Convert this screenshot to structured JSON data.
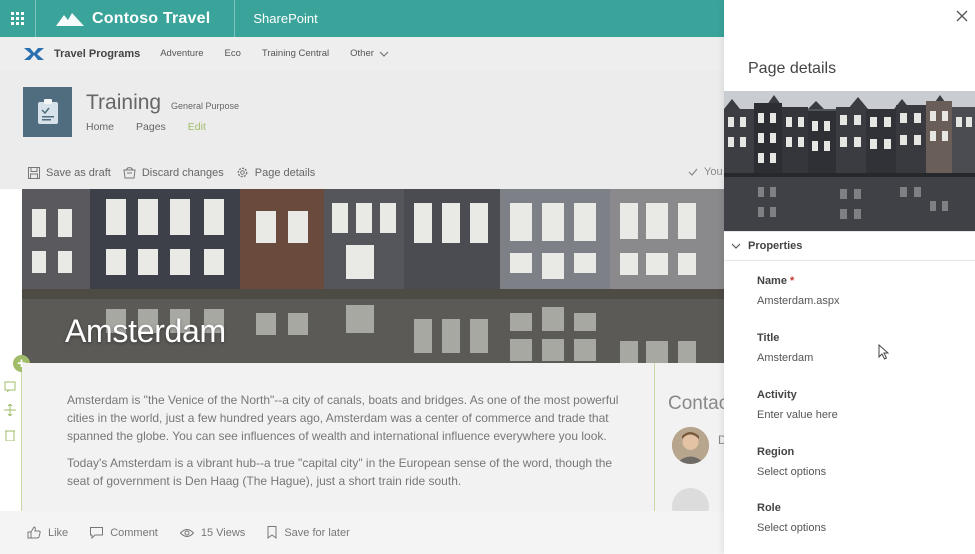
{
  "suite": {
    "brand": "Contoso Travel",
    "product": "SharePoint"
  },
  "hub": {
    "title": "Travel Programs",
    "links": [
      "Adventure",
      "Eco",
      "Training Central",
      "Other"
    ]
  },
  "site": {
    "title": "Training",
    "classification": "General Purpose",
    "nav": [
      "Home",
      "Pages",
      "Edit"
    ]
  },
  "commands": {
    "save_draft": "Save as draft",
    "discard": "Discard changes",
    "page_details": "Page details",
    "status": "You"
  },
  "hero": {
    "title": "Amsterdam"
  },
  "article": {
    "paragraphs": [
      "Amsterdam is \"the Venice of the North\"--a city of canals, boats and bridges. As one of the most powerful cities in the world, just a few hundred years ago, Amsterdam was a center of commerce and trade that spanned the globe.  You can see influences of wealth and international influence everywhere you look.",
      "Today's Amsterdam is a vibrant hub--a true \"capital city\" in the European sense of the word, though the seat of government is Den Haag (The Hague), just a short train ride south."
    ]
  },
  "contact": {
    "title": "Contact",
    "initial": "D"
  },
  "footer": {
    "like": "Like",
    "comment": "Comment",
    "views": "15 Views",
    "save_later": "Save for later"
  },
  "panel": {
    "title": "Page details",
    "properties_label": "Properties",
    "fields": [
      {
        "label": "Name",
        "value": "Amsterdam.aspx",
        "required": true
      },
      {
        "label": "Title",
        "value": "Amsterdam",
        "required": false
      },
      {
        "label": "Activity",
        "value": "Enter value here",
        "required": false
      },
      {
        "label": "Region",
        "value": "Select options",
        "required": false
      },
      {
        "label": "Role",
        "value": "Select options",
        "required": false
      }
    ]
  },
  "colors": {
    "suite_bar": "#3aa49b",
    "accent_green": "#a1bd6a",
    "required": "#c0392b"
  },
  "icons": [
    "waffle-icon",
    "mountain-logo-icon",
    "hub-x-logo-icon",
    "chevron-down-icon",
    "clipboard-icon",
    "save-icon",
    "discard-icon",
    "gear-icon",
    "check-icon",
    "plus-icon",
    "like-icon",
    "comment-icon",
    "eye-icon",
    "bookmark-icon",
    "close-icon",
    "chevron-down-icon",
    "pointer-cursor-icon"
  ]
}
